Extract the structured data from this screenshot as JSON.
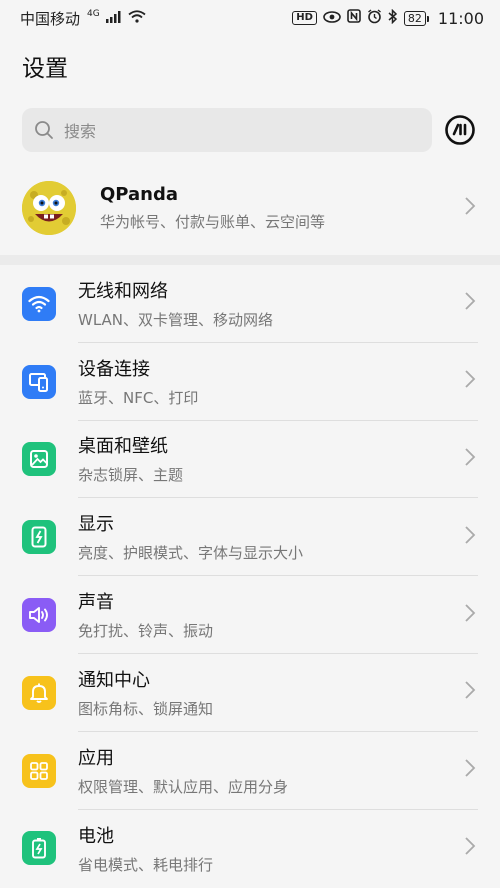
{
  "status_bar": {
    "carrier": "中国移动",
    "network": "4G",
    "hd": "HD",
    "battery": "82",
    "time": "11:00"
  },
  "header": {
    "title": "设置"
  },
  "search": {
    "placeholder": "搜索"
  },
  "account": {
    "name": "QPanda",
    "subtitle": "华为帐号、付款与账单、云空间等"
  },
  "items": [
    {
      "title": "无线和网络",
      "subtitle": "WLAN、双卡管理、移动网络",
      "icon": "wifi-icon",
      "color": "#2f7cf6"
    },
    {
      "title": "设备连接",
      "subtitle": "蓝牙、NFC、打印",
      "icon": "device-connection-icon",
      "color": "#2f7cf6"
    },
    {
      "title": "桌面和壁纸",
      "subtitle": "杂志锁屏、主题",
      "icon": "wallpaper-icon",
      "color": "#1fc27c"
    },
    {
      "title": "显示",
      "subtitle": "亮度、护眼模式、字体与显示大小",
      "icon": "display-icon",
      "color": "#1fc27c"
    },
    {
      "title": "声音",
      "subtitle": "免打扰、铃声、振动",
      "icon": "sound-icon",
      "color": "#8a5cf5"
    },
    {
      "title": "通知中心",
      "subtitle": "图标角标、锁屏通知",
      "icon": "bell-icon",
      "color": "#f7c21b"
    },
    {
      "title": "应用",
      "subtitle": "权限管理、默认应用、应用分身",
      "icon": "apps-icon",
      "color": "#f7c21b"
    },
    {
      "title": "电池",
      "subtitle": "省电模式、耗电排行",
      "icon": "battery-icon",
      "color": "#1fc27c"
    }
  ]
}
